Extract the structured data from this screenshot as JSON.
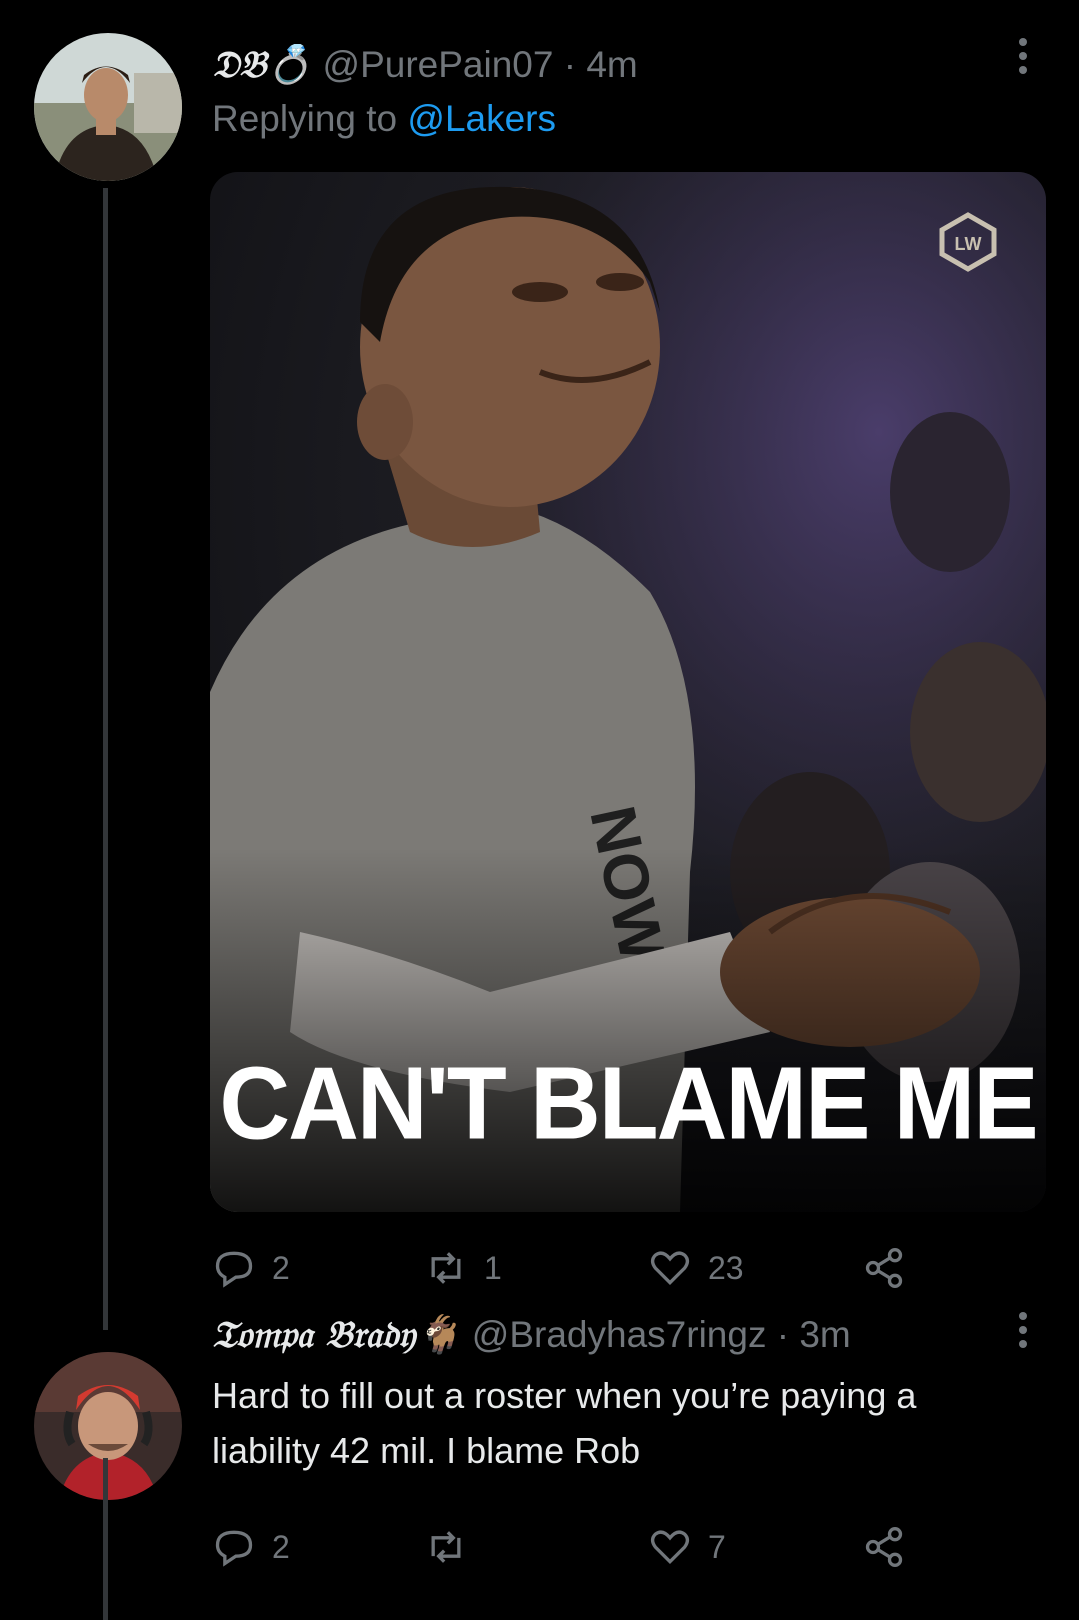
{
  "tweet1": {
    "display_name": "𝔇𝔅💍",
    "handle": "@PurePain07",
    "time": "· 4m",
    "replying_prefix": "Replying to",
    "replying_to": "@Lakers",
    "media_caption": "CAN'T BLAME ME",
    "watermark_label": "LW",
    "replies": "2",
    "retweets": "1",
    "likes": "23"
  },
  "tweet2": {
    "display_name": "𝔗𝔬𝔪𝔭𝔞 𝔅𝔯𝔞𝔡𝔶🐐",
    "handle": "@Bradyhas7ringz",
    "time": "· 3m",
    "text": "Hard to fill out a roster when you’re paying a liability 42 mil. I blame Rob",
    "replies": "2",
    "retweets": "",
    "likes": "7"
  },
  "icons": {
    "reply": "reply-icon",
    "retweet": "retweet-icon",
    "like": "heart-icon",
    "share": "share-icon",
    "more": "more-icon"
  },
  "colors": {
    "background": "#000000",
    "muted": "#71767b",
    "link": "#1d9bf0",
    "text": "#e7e9ea"
  }
}
